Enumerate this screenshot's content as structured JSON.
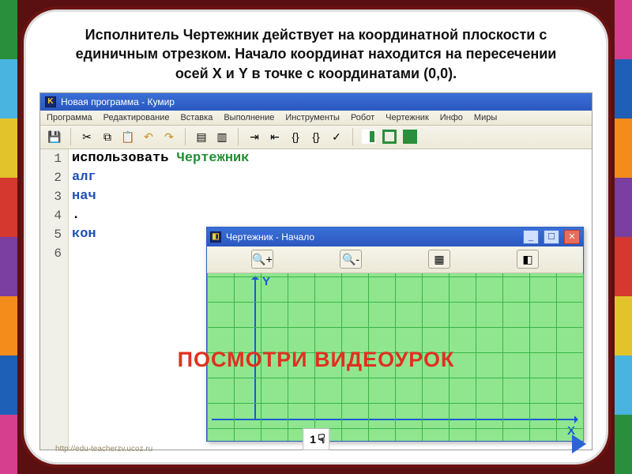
{
  "heading": "Исполнитель Чертежник действует на координатной плоскости с единичным отрезком. Начало координат находится на пересечении осей X и Y  в точке с координатами (0,0).",
  "app": {
    "title": "Новая программа - Кумир",
    "badge": "K",
    "menu": [
      "Программа",
      "Редактирование",
      "Вставка",
      "Выполнение",
      "Инструменты",
      "Робот",
      "Чертежник",
      "Инфо",
      "Миры"
    ]
  },
  "code": {
    "lines": [
      "1",
      "2",
      "3",
      "4",
      "5",
      "6"
    ],
    "l1a": "использовать ",
    "l1b": "Чертежник",
    "l2": "алг",
    "l3": "нач",
    "l4": ".",
    "l5": "кон"
  },
  "subwin": {
    "title": "Чертежник - Начало",
    "y_label": "Y",
    "x_label": "X"
  },
  "overlay": "ПОСМОТРИ   ВИДЕОУРОК",
  "page_number": "1",
  "footer": "http://edu-teacherzv.ucoz.ru"
}
